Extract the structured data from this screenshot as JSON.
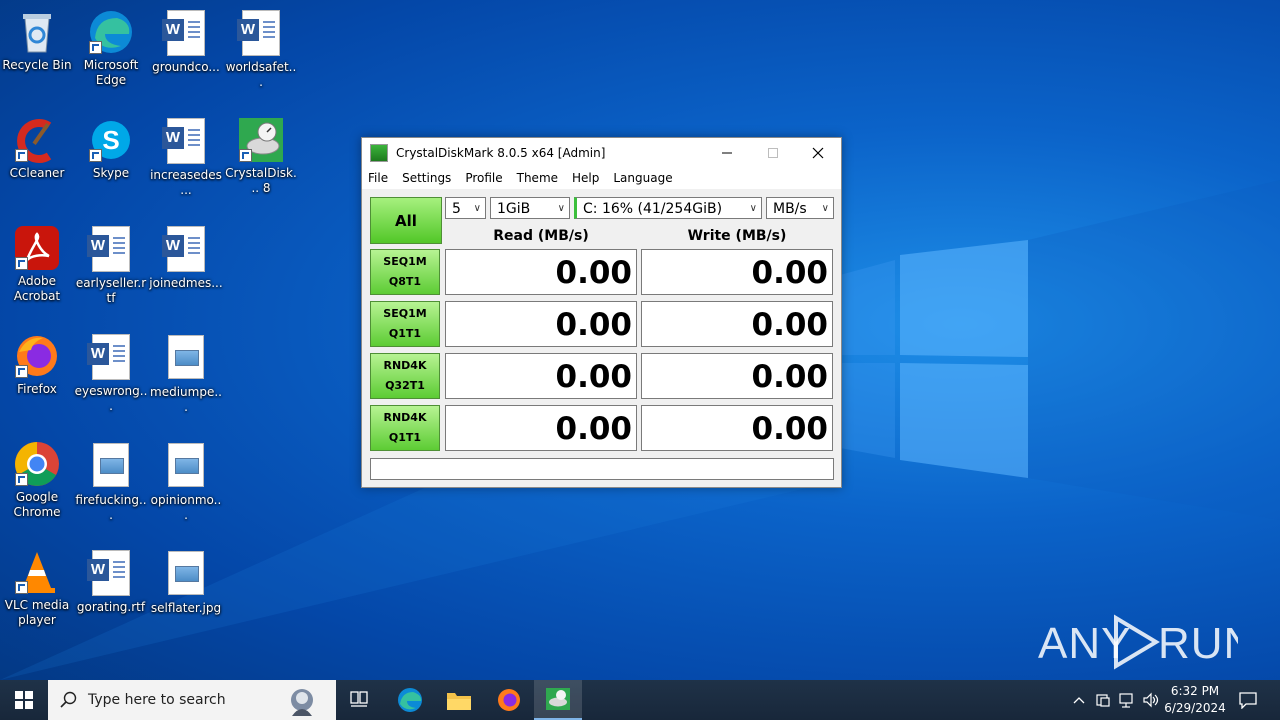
{
  "desktop": {
    "icons": [
      {
        "label": "Recycle Bin",
        "icon": "recycle-bin-icon"
      },
      {
        "label": "Microsoft Edge",
        "icon": "edge-icon"
      },
      {
        "label": "groundco...",
        "icon": "word-doc-icon"
      },
      {
        "label": "worldsafet...",
        "icon": "word-doc-icon"
      },
      {
        "label": "CCleaner",
        "icon": "ccleaner-icon"
      },
      {
        "label": "Skype",
        "icon": "skype-icon"
      },
      {
        "label": "increasedes...",
        "icon": "word-doc-icon"
      },
      {
        "label": "CrystalDisk... 8",
        "icon": "crystaldiskmark-icon"
      },
      {
        "label": "Adobe Acrobat",
        "icon": "acrobat-icon"
      },
      {
        "label": "earlyseller.rtf",
        "icon": "word-doc-icon"
      },
      {
        "label": "joinedmes...",
        "icon": "word-doc-icon"
      },
      {
        "label": "Firefox",
        "icon": "firefox-icon"
      },
      {
        "label": "eyeswrong...",
        "icon": "word-doc-icon"
      },
      {
        "label": "mediumpe...",
        "icon": "image-file-icon"
      },
      {
        "label": "Google Chrome",
        "icon": "chrome-icon"
      },
      {
        "label": "firefucking...",
        "icon": "image-file-icon"
      },
      {
        "label": "opinionmo...",
        "icon": "image-file-icon"
      },
      {
        "label": "VLC media player",
        "icon": "vlc-icon"
      },
      {
        "label": "gorating.rtf",
        "icon": "word-doc-icon"
      },
      {
        "label": "selflater.jpg",
        "icon": "image-file-icon"
      }
    ]
  },
  "window": {
    "title": "CrystalDiskMark 8.0.5 x64 [Admin]",
    "menu": [
      "File",
      "Settings",
      "Profile",
      "Theme",
      "Help",
      "Language"
    ],
    "all_button": "All",
    "count_select": "5",
    "size_select": "1GiB",
    "drive_select": "C: 16% (41/254GiB)",
    "unit_select": "MB/s",
    "read_header": "Read (MB/s)",
    "write_header": "Write (MB/s)",
    "tests": [
      {
        "line1": "SEQ1M",
        "line2": "Q8T1",
        "read": "0.00",
        "write": "0.00"
      },
      {
        "line1": "SEQ1M",
        "line2": "Q1T1",
        "read": "0.00",
        "write": "0.00"
      },
      {
        "line1": "RND4K",
        "line2": "Q32T1",
        "read": "0.00",
        "write": "0.00"
      },
      {
        "line1": "RND4K",
        "line2": "Q1T1",
        "read": "0.00",
        "write": "0.00"
      }
    ],
    "comment": ""
  },
  "taskbar": {
    "search_placeholder": "Type here to search",
    "time": "6:32 PM",
    "date": "6/29/2024"
  },
  "watermark": "ANY RUN"
}
